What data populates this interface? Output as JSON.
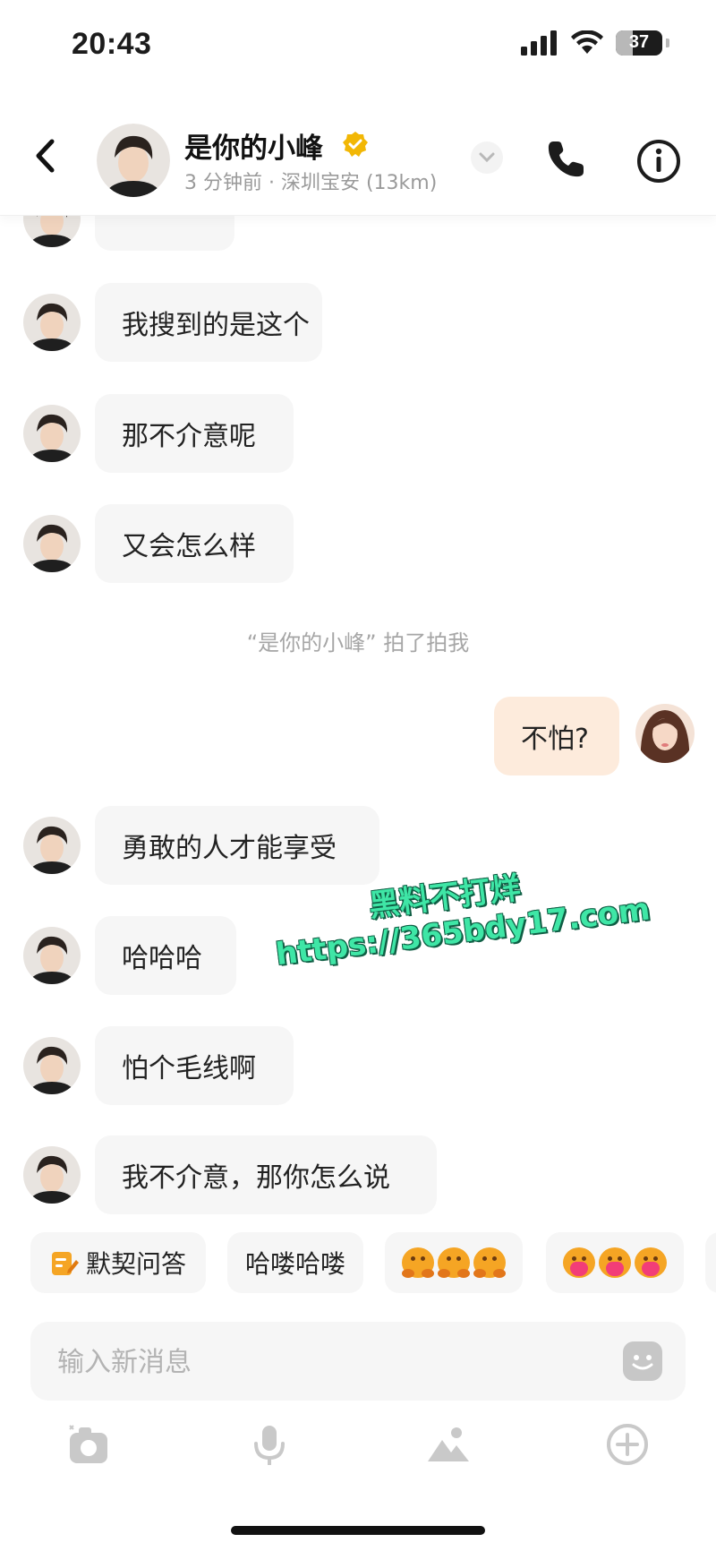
{
  "status_bar": {
    "time": "20:43",
    "battery": "37",
    "battery_level": 0.37
  },
  "header": {
    "contact_name": "是你的小峰",
    "contact_status": "3 分钟前 · 深圳宝安 (13km)"
  },
  "messages": [
    {
      "side": "left",
      "text": "我搜到的是这个"
    },
    {
      "side": "left",
      "text": "那不介意呢"
    },
    {
      "side": "left",
      "text": "又会怎么样"
    },
    {
      "side": "right",
      "text": "不怕?"
    },
    {
      "side": "left",
      "text": "勇敢的人才能享受"
    },
    {
      "side": "left",
      "text": "哈哈哈"
    },
    {
      "side": "left",
      "text": "怕个毛线啊"
    },
    {
      "side": "left",
      "text": "我不介意，那你怎么说"
    }
  ],
  "system_note": "“是你的小峰” 拍了拍我",
  "watermark": {
    "line1": "黑料不打烊",
    "line2": "https://365bdy17.com"
  },
  "quick_replies": {
    "tacit_quiz": "默契问答",
    "hello": "哈喽哈喽",
    "emoji_set_1": "ducks-waving-emoji",
    "emoji_set_2": "ducks-heart-emoji"
  },
  "composer": {
    "placeholder": "输入新消息"
  },
  "colors": {
    "self_bubble": "#fdebdc",
    "other_bubble": "#f6f6f6",
    "verified": "#f2b705",
    "watermark": "#3fe6a6"
  }
}
